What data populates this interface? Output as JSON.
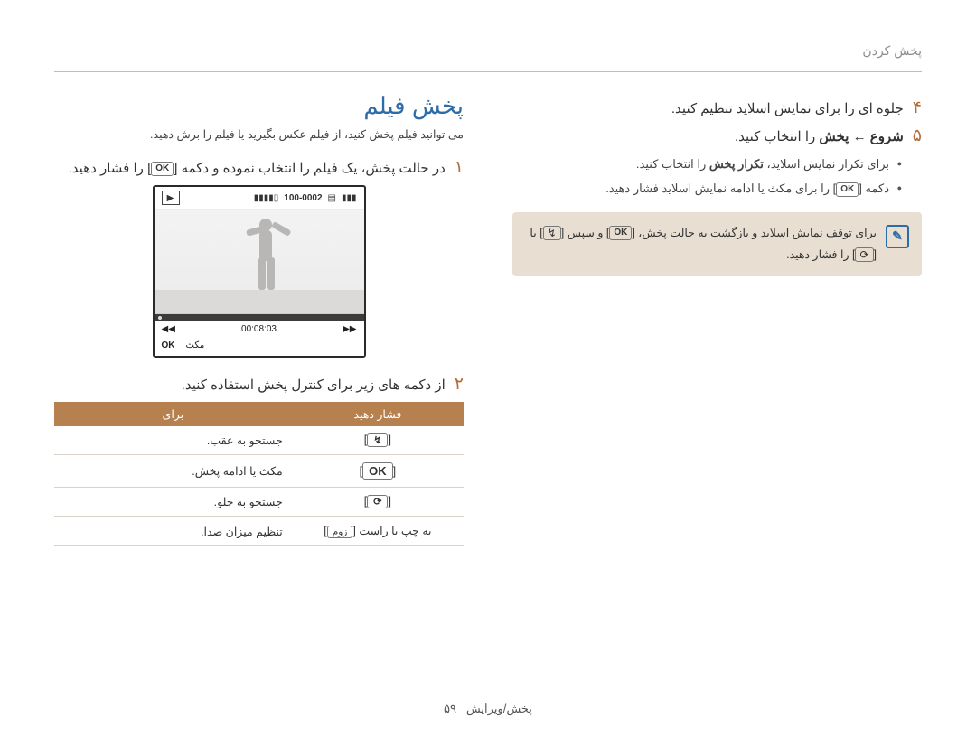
{
  "header": {
    "breadcrumb": "پخش کردن"
  },
  "right": {
    "step4_num": "۴",
    "step4": "جلوه ای را برای نمایش اسلاید تنظیم کنید.",
    "step5_num": "۵",
    "step5_pre": "شروع ← پخش",
    "step5_post": " را انتخاب کنید.",
    "bullet1_pre": "برای تکرار نمایش اسلاید، ",
    "bullet1_bold": "تکرار پخش",
    "bullet1_post": " را انتخاب کنید.",
    "bullet2_pre": "دکمه ",
    "bullet2_post": " را برای مکث یا ادامه نمایش اسلاید فشار دهید.",
    "note_pre": "برای توقف نمایش اسلاید و بازگشت به حالت پخش، ",
    "note_mid": " و سپس ",
    "note_or": " یا ",
    "note_post": " را فشار دهید."
  },
  "left": {
    "title": "پخش فیلم",
    "subtitle": "می توانید فیلم پخش کنید، از فیلم عکس بگیرید یا فیلم را برش دهید.",
    "step1_num": "۱",
    "step1_pre": "در حالت پخش، یک فیلم را انتخاب نموده و دکمه ",
    "step1_post": " را فشار دهید.",
    "video": {
      "counter": "100-0002",
      "time": "00:08:03",
      "pause_label": "مکث"
    },
    "step2_num": "۲",
    "step2": "از دکمه های زیر برای کنترل پخش استفاده کنید.",
    "table": {
      "th_press": "فشار دهید",
      "th_for": "برای",
      "rows": [
        {
          "key_sym": "↯",
          "desc": "جستجو به عقب."
        },
        {
          "key_text": "OK",
          "desc": "مکث یا ادامه پخش."
        },
        {
          "key_sym": "⟳",
          "desc": "جستجو به جلو."
        },
        {
          "zoom_label": "زوم",
          "key_text_suffix": "به چپ یا راست ",
          "desc": "تنظیم میزان صدا."
        }
      ]
    }
  },
  "labels": {
    "ok": "OK"
  },
  "footer": {
    "section": "پخش/ویرایش",
    "page": "۵۹"
  }
}
